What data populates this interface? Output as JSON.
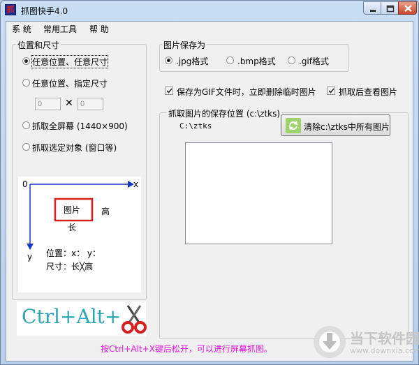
{
  "window": {
    "title": "抓图快手4.0",
    "app_icon_char": "抓"
  },
  "menu": {
    "items": [
      "系 统",
      "常用工具",
      "帮 助"
    ]
  },
  "position_group": {
    "title": "位置和尺寸",
    "options": [
      "任意位置、任意尺寸",
      "任意位置、指定尺寸",
      "抓取全屏幕 (1440×900)",
      "抓取选定对象 (窗口等)"
    ],
    "selected": 0,
    "width_value": "0",
    "height_value": "0",
    "times_symbol": "✕"
  },
  "diagram": {
    "origin": "0",
    "x_axis": "x",
    "y_axis": "y",
    "box_label": "图片",
    "height_label": "高",
    "length_label": "长",
    "position_line": "位置：x：  y：",
    "size_line": "尺寸：长╳高",
    "box_color": "#d81e1e",
    "axis_color": "#1a36c8"
  },
  "format_group": {
    "title": "图片保存为",
    "options": [
      ".jpg格式",
      ".bmp格式",
      ".gif格式"
    ],
    "selected": 0
  },
  "options": {
    "delete_temp_label": "保存为GIF文件时，立即删除临时图片",
    "delete_temp_checked": true,
    "view_after_label": "抓取后查看图片",
    "view_after_checked": true
  },
  "save_group": {
    "title": "抓取图片的保存位置 (c:\\ztks)",
    "path": "C:\\ztks",
    "clear_button_label": "清除c:\\ztks中所有图片"
  },
  "hotkey": {
    "text": "Ctrl+Alt+",
    "text_color": "#2aa6b5",
    "icon": "scissors-icon"
  },
  "hint": {
    "text": "按Ctrl+Alt+X键后松开，可以进行屏幕抓图。",
    "color": "#e316e3"
  },
  "watermark": {
    "brand": "当下软件园",
    "site": "www.downxia.com"
  }
}
